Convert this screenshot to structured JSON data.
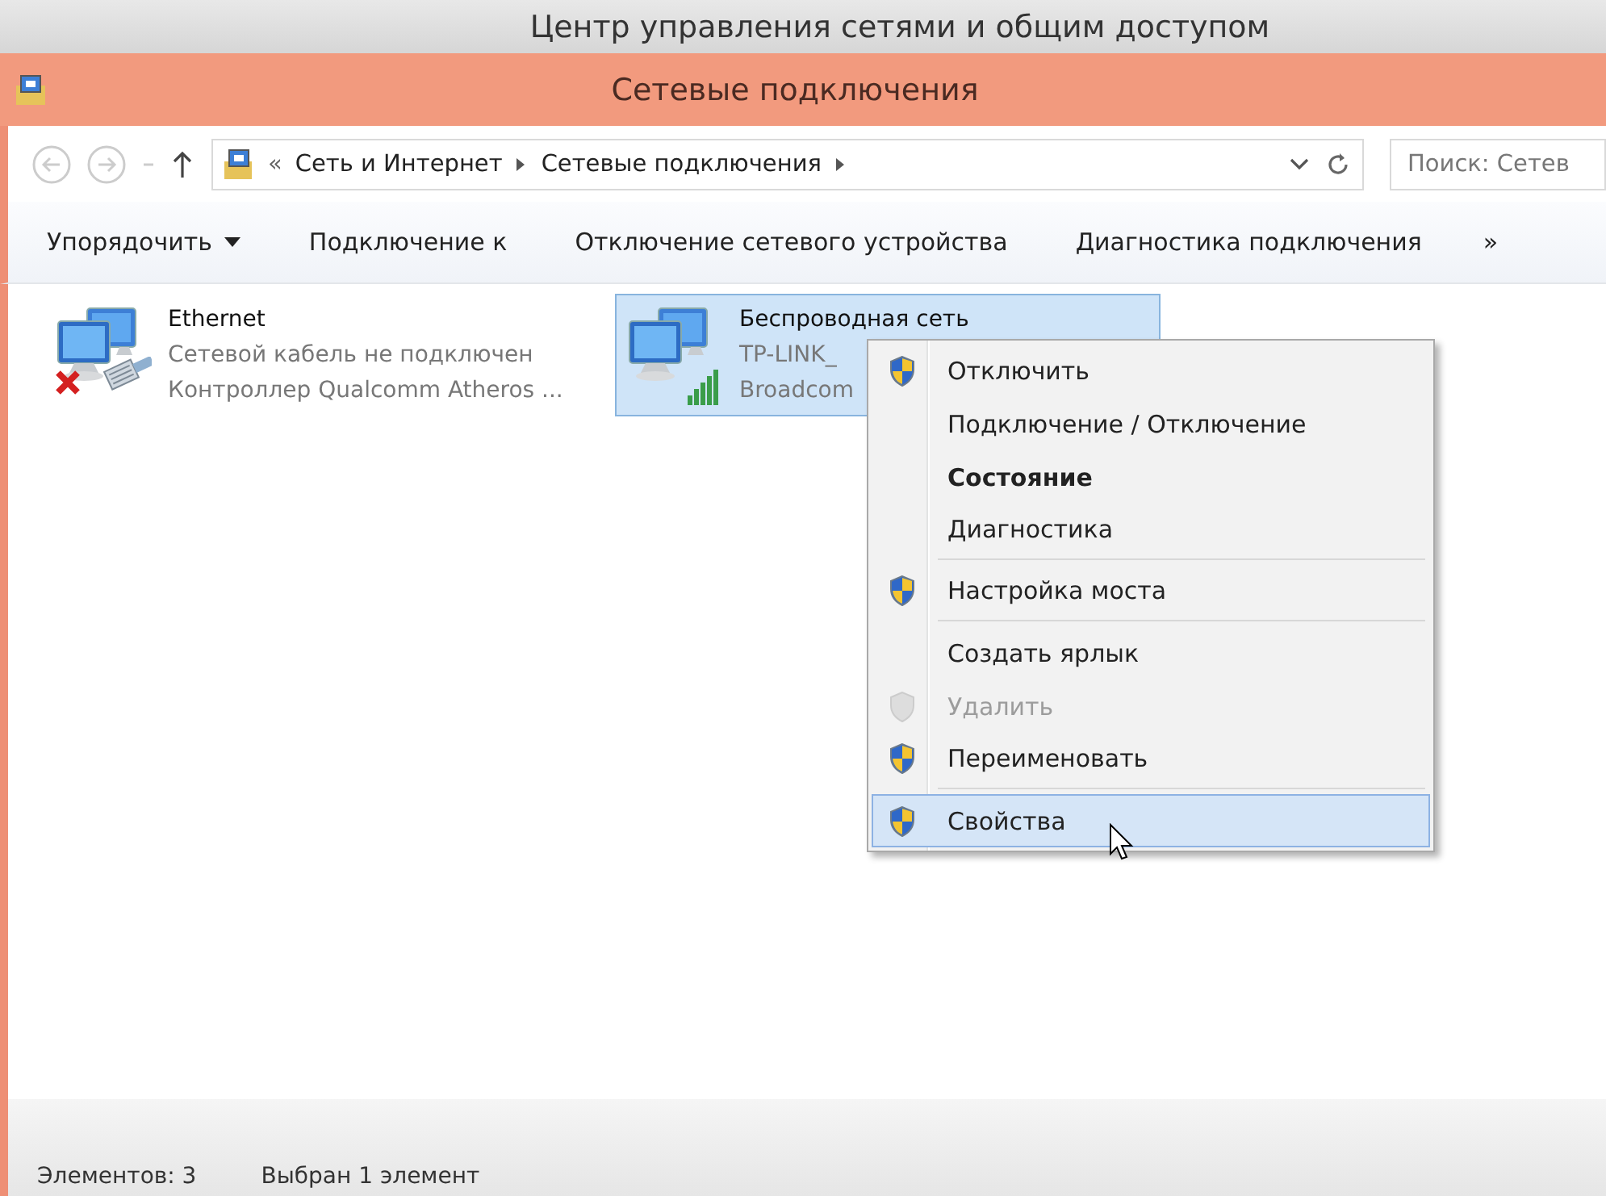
{
  "outer_window": {
    "title": "Центр управления сетями и общим доступом"
  },
  "window": {
    "title": "Сетевые подключения"
  },
  "address_bar": {
    "overflow": "«",
    "breadcrumbs": [
      "Сеть и Интернет",
      "Сетевые подключения"
    ],
    "search": {
      "placeholder": "Поиск: Сетев"
    }
  },
  "toolbar": {
    "items": [
      {
        "label": "Упорядочить",
        "dropdown": true
      },
      {
        "label": "Подключение к",
        "dropdown": false
      },
      {
        "label": "Отключение сетевого устройства",
        "dropdown": false
      },
      {
        "label": "Диагностика подключения",
        "dropdown": false
      }
    ],
    "more": "»"
  },
  "connections": [
    {
      "name": "Ethernet",
      "details": [
        "Сетевой кабель не подключен",
        "Контроллер Qualcomm Atheros ..."
      ],
      "kind": "disconnected",
      "selected": false
    },
    {
      "name": "Беспроводная сеть",
      "details": [
        "TP-LINK_",
        "Broadcom"
      ],
      "kind": "wireless",
      "selected": true
    }
  ],
  "context_menu": {
    "items": [
      {
        "label": "Отключить",
        "shield": true,
        "bold": false,
        "disabled": false,
        "selected": false,
        "separator_after": false
      },
      {
        "label": "Подключение / Отключение",
        "shield": false,
        "bold": false,
        "disabled": false,
        "selected": false,
        "separator_after": false
      },
      {
        "label": "Состояние",
        "shield": false,
        "bold": true,
        "disabled": false,
        "selected": false,
        "separator_after": false
      },
      {
        "label": "Диагностика",
        "shield": false,
        "bold": false,
        "disabled": false,
        "selected": false,
        "separator_after": true
      },
      {
        "label": "Настройка моста",
        "shield": true,
        "bold": false,
        "disabled": false,
        "selected": false,
        "separator_after": true
      },
      {
        "label": "Создать ярлык",
        "shield": false,
        "bold": false,
        "disabled": false,
        "selected": false,
        "separator_after": false
      },
      {
        "label": "Удалить",
        "shield": true,
        "bold": false,
        "disabled": true,
        "selected": false,
        "separator_after": false
      },
      {
        "label": "Переименовать",
        "shield": true,
        "bold": false,
        "disabled": false,
        "selected": false,
        "separator_after": true
      },
      {
        "label": "Свойства",
        "shield": true,
        "bold": false,
        "disabled": false,
        "selected": true,
        "separator_after": false
      }
    ]
  },
  "status_bar": {
    "items": [
      "Элементов: 3",
      "Выбран 1 элемент"
    ]
  }
}
